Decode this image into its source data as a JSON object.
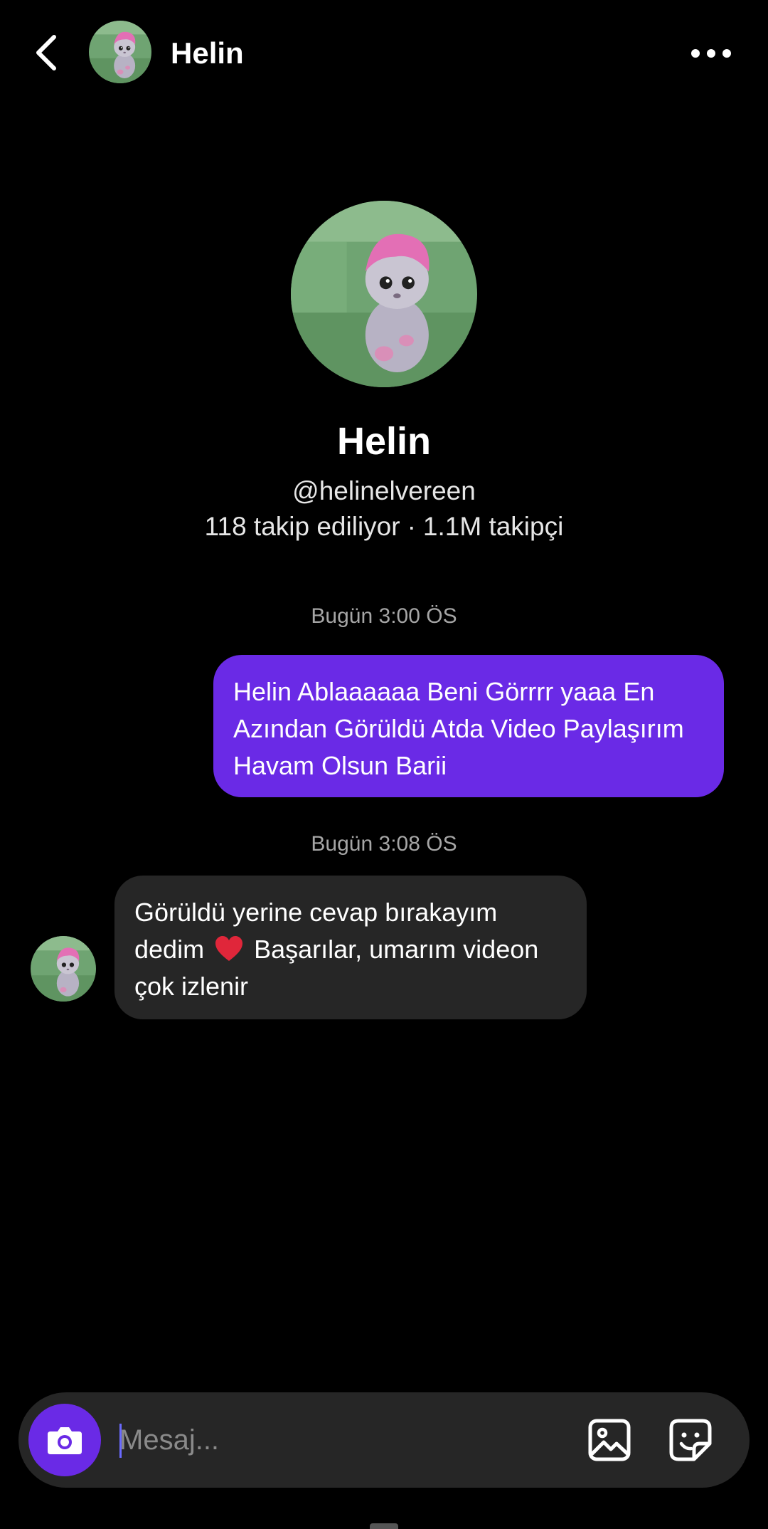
{
  "header": {
    "name": "Helin"
  },
  "profile": {
    "name": "Helin",
    "handle": "@helinelvereen",
    "following": "118 takip ediliyor",
    "separator": "·",
    "followers": "1.1M takipçi"
  },
  "messages": [
    {
      "timestamp": "Bugün 3:00 ÖS",
      "direction": "outgoing",
      "lines": [
        "Helin Ablaaaaaa Beni Görrrr yaaa En",
        "Azından Görüldü Atda Video Paylaşırım",
        "Havam Olsun Barii"
      ]
    },
    {
      "timestamp": "Bugün 3:08 ÖS",
      "direction": "incoming",
      "line1": "Görüldü yerine cevap bırakayım",
      "line2_before": "dedim",
      "line2_after": "Başarılar, umarım videon",
      "line3": "çok izlenir"
    }
  ],
  "composer": {
    "placeholder": "Mesaj..."
  },
  "colors": {
    "accent": "#6a2ae6",
    "bubble_in": "#262626",
    "background": "#000000"
  },
  "icons": {
    "back": "chevron-left-icon",
    "more": "more-horizontal-icon",
    "camera": "camera-icon",
    "gallery": "image-icon",
    "sticker": "sticker-icon",
    "heart": "red-heart-icon"
  }
}
